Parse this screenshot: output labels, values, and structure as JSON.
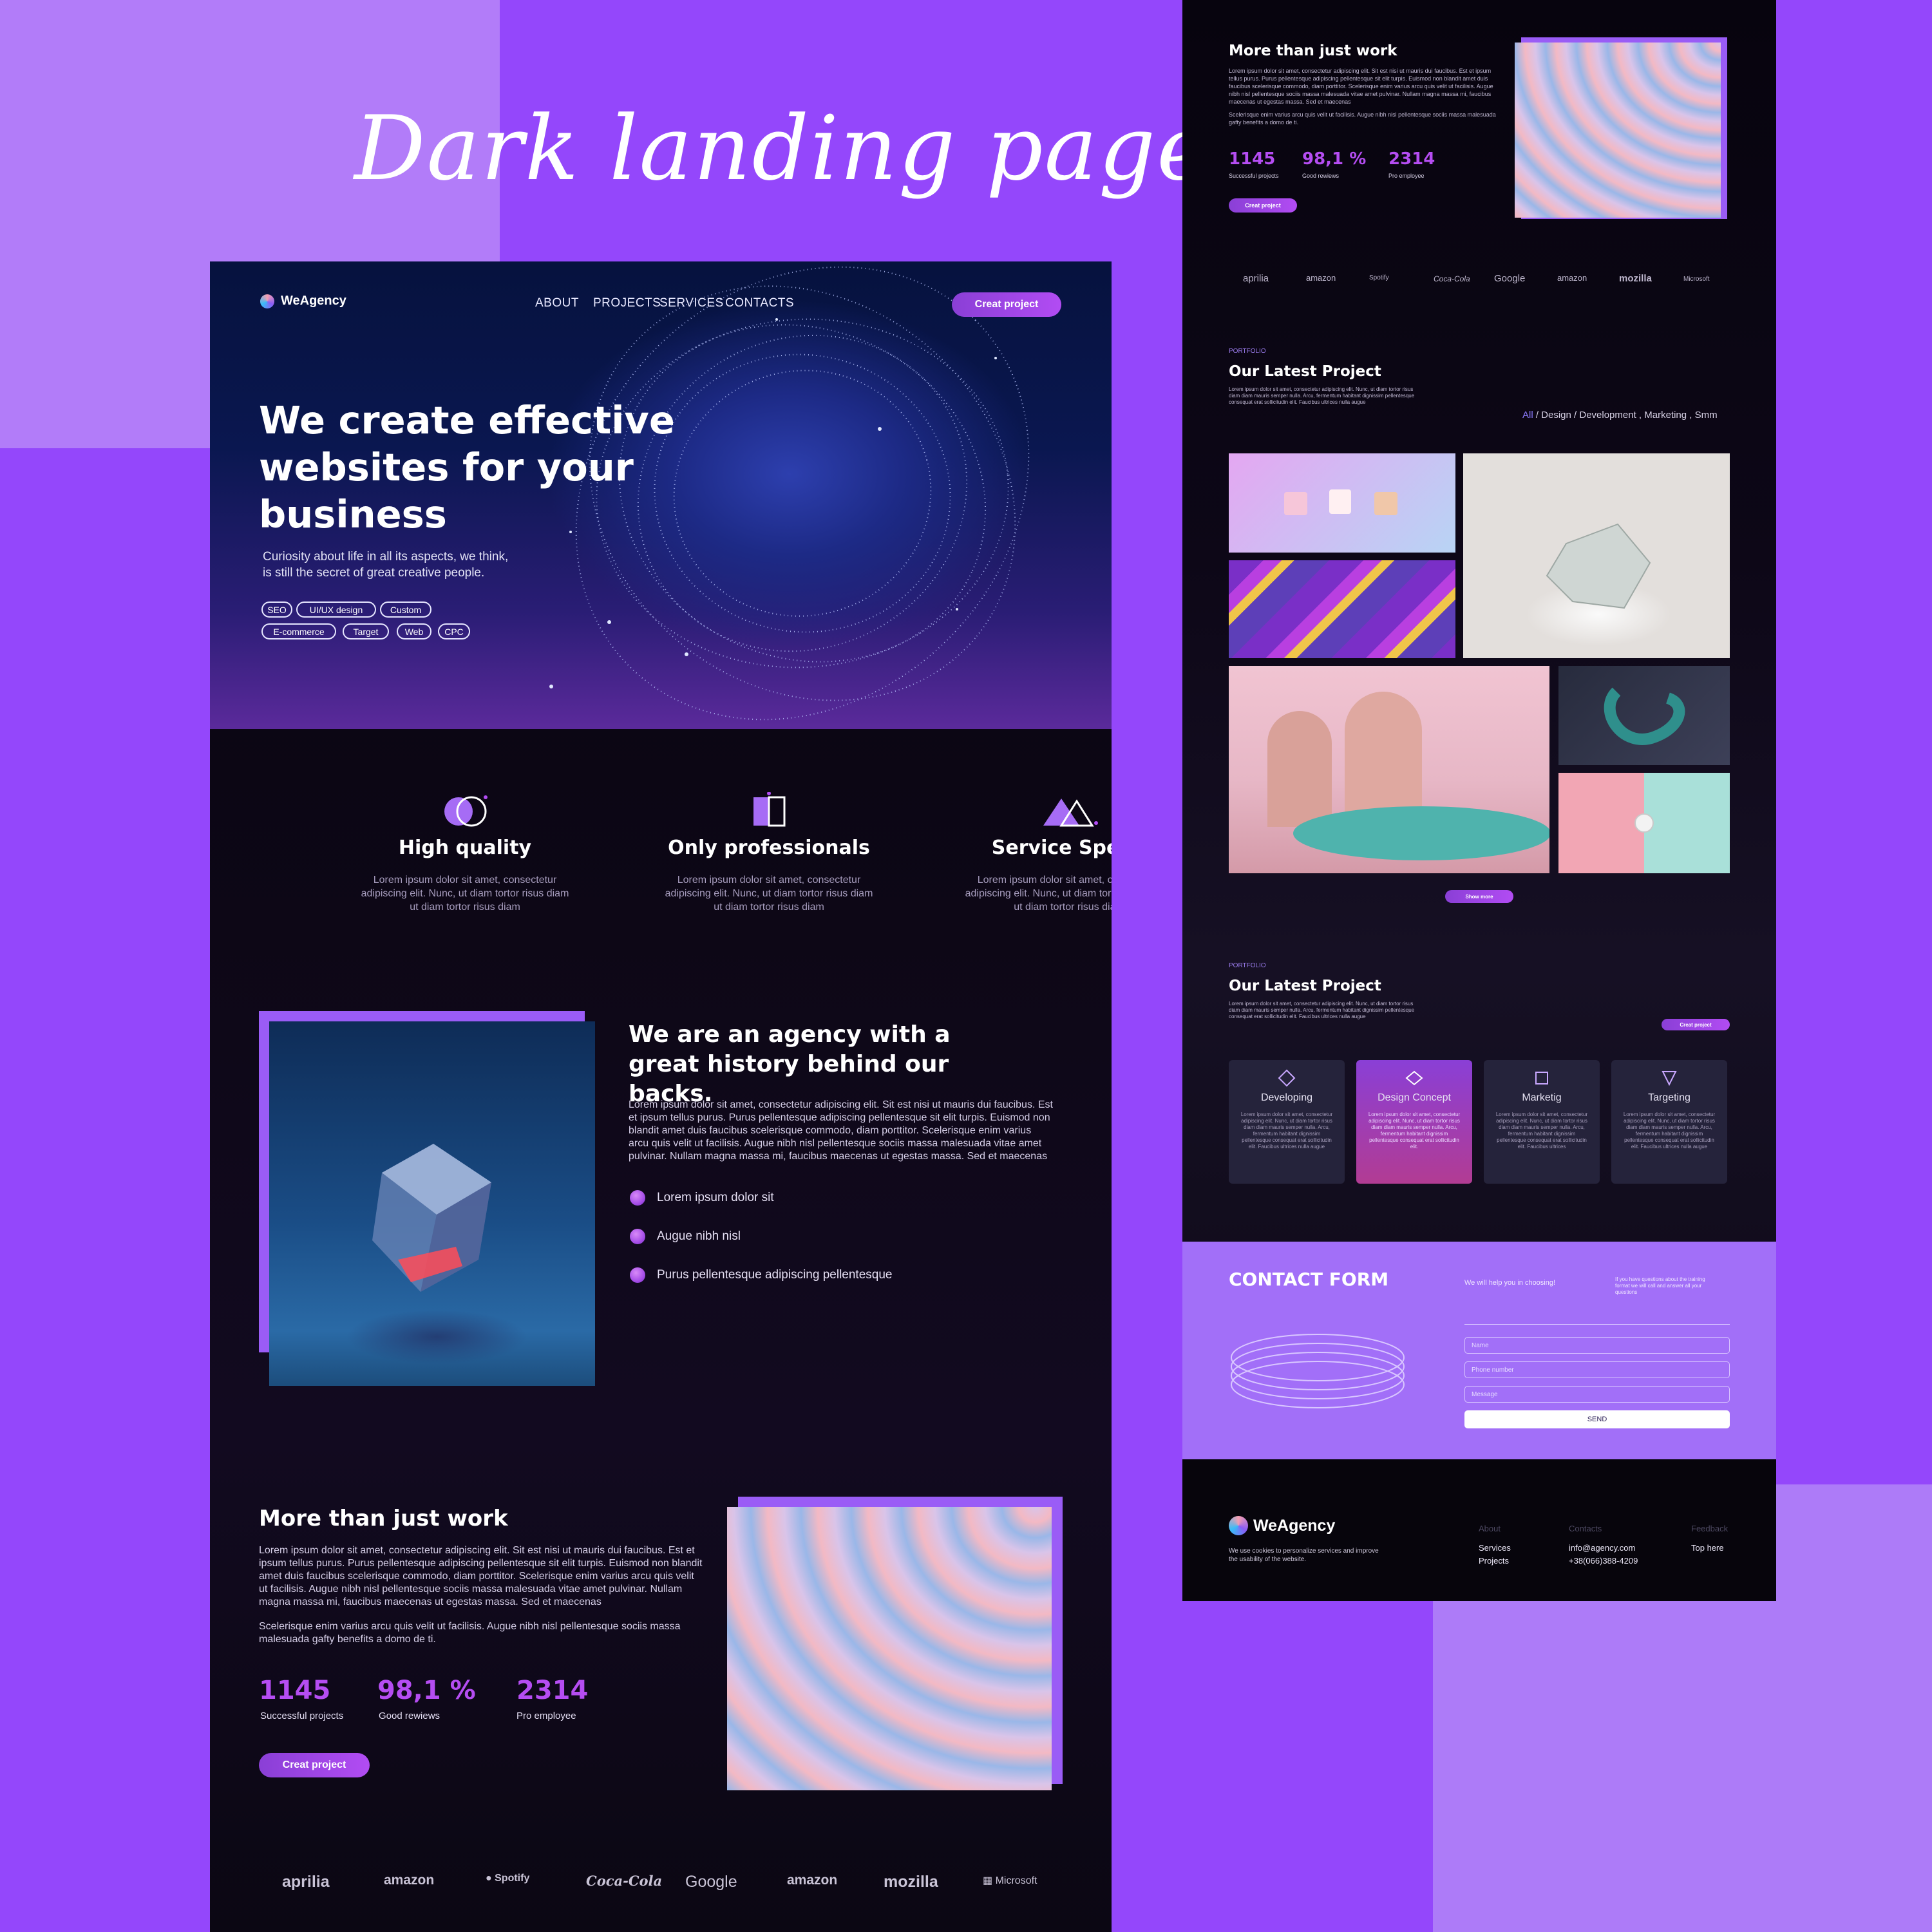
{
  "showcase": {
    "title": "Dark landing page"
  },
  "brand_name": "WeAgency",
  "nav": {
    "about": "ABOUT",
    "projects": "PROJECTS",
    "services": "SERVICES",
    "contacts": "CONTACTS",
    "cta": "Creat project"
  },
  "hero": {
    "title_line1": "We create effective",
    "title_line2": "websites  for your",
    "title_line3": "business",
    "sub_line1": "Curiosity about life in all its aspects, we think,",
    "sub_line2": "is still the secret of great creative people.",
    "tags": [
      "SEO",
      "UI/UX design",
      "Custom",
      "E-commerce",
      "Target",
      "Web",
      "CPC"
    ]
  },
  "features": [
    {
      "title": "High quality",
      "text": "Lorem ipsum dolor sit amet, consectetur adipiscing elit. Nunc, ut diam tortor risus diam ut diam tortor risus diam"
    },
    {
      "title": "Only professionals",
      "text": "Lorem ipsum dolor sit amet, consectetur adipiscing elit. Nunc, ut diam tortor risus diam ut diam tortor risus diam"
    },
    {
      "title": "Service Speed",
      "text": "Lorem ipsum dolor sit amet, consectetur adipiscing elit. Nunc, ut diam tortor risus diam ut diam tortor risus diam"
    }
  ],
  "about": {
    "title": "We are an agency with a great history behind our backs.",
    "body": "Lorem ipsum dolor sit amet, consectetur adipiscing elit. Sit est nisi ut mauris dui faucibus. Est et ipsum tellus purus. Purus pellentesque adipiscing pellentesque sit elit turpis. Euismod non blandit amet duis faucibus scelerisque commodo, diam porttitor. Scelerisque enim varius arcu quis velit ut facilisis. Augue nibh nisl pellentesque sociis massa malesuada vitae amet pulvinar. Nullam magna massa mi, faucibus maecenas ut egestas massa. Sed et maecenas",
    "bullets": [
      "Lorem ipsum dolor sit",
      "Augue nibh nisl",
      "Purus pellentesque adipiscing pellentesque"
    ]
  },
  "more": {
    "title": "More than just work",
    "body1": "Lorem ipsum dolor sit amet, consectetur adipiscing elit. Sit est nisi ut mauris dui faucibus. Est et ipsum tellus purus. Purus pellentesque adipiscing pellentesque sit elit turpis. Euismod non blandit amet duis faucibus scelerisque commodo, diam porttitor. Scelerisque enim varius arcu quis velit ut facilisis. Augue nibh nisl pellentesque sociis massa malesuada vitae amet pulvinar. Nullam magna massa mi, faucibus maecenas ut egestas massa. Sed et maecenas",
    "body2": "Scelerisque enim varius arcu quis velit ut facilisis. Augue nibh nisl pellentesque sociis massa malesuada gafty benefits a domo de ti.",
    "stats": [
      {
        "value": "1145",
        "label": "Successful projects"
      },
      {
        "value": "98,1 %",
        "label": "Good rewiews"
      },
      {
        "value": "2314",
        "label": "Pro  employee"
      }
    ],
    "cta": "Creat project"
  },
  "brands": [
    "aprilia",
    "amazon",
    "Spotify",
    "Coca-Cola",
    "Google",
    "amazon",
    "mozilla",
    "Microsoft"
  ],
  "right": {
    "more_stats": [
      {
        "value": "1145",
        "label": "Successful projects"
      },
      {
        "value": "98,1 %",
        "label": "Good rewiews"
      },
      {
        "value": "2314",
        "label": "Pro  employee"
      }
    ],
    "portfolio_label": "PORTFOLIO",
    "portfolio_title": "Our Latest Project",
    "portfolio_text": "Lorem ipsum dolor sit amet, consectetur adipiscing elit. Nunc, ut diam tortor risus diam diam mauris semper nulla. Arcu, fermentum habitant dignissim pellentesque consequat erat sollicitudin elit. Faucibus ultrices nulla augue",
    "filters": {
      "all": "All",
      "rest": " / Design / Development , Marketing , Smm"
    },
    "show_more": "Show more",
    "services_cta": "Creat project",
    "services": [
      {
        "title": "Developing",
        "text": "Lorem ipsum dolor sit amet, consectetur adipiscing elit. Nunc, ut diam tortor risus diam diam mauris semper nulla. Arcu, fermentum habitant dignissim pellentesque consequat erat sollicitudin elit. Faucibus ultrices nulla augue"
      },
      {
        "title": "Design Concept",
        "text": "Lorem ipsum dolor sit amet, consectetur adipiscing elit. Nunc, ut diam tortor risus diam diam mauris semper nulla. Arcu, fermentum habitant dignissim pellentesque consequat erat sollicitudin elit."
      },
      {
        "title": "Marketig",
        "text": "Lorem ipsum dolor sit amet, consectetur adipiscing elit. Nunc, ut diam tortor risus diam diam mauris semper nulla. Arcu, fermentum habitant dignissim pellentesque consequat erat sollicitudin elit. Faucibus ultrices"
      },
      {
        "title": "Targeting",
        "text": "Lorem ipsum dolor sit amet, consectetur adipiscing elit. Nunc, ut diam tortor risus diam diam mauris semper nulla. Arcu, fermentum habitant dignissim pellentesque consequat erat sollicitudin elit. Faucibus ultrices nulla augue"
      }
    ],
    "contact": {
      "title": "CONTACT FORM",
      "help": "We will help you in choosing!",
      "note": "If you have questions about the training format we will call and answer all your questions",
      "name_ph": "Name",
      "phone_ph": "Phone number",
      "message_ph": "Message",
      "send": "SEND"
    },
    "footer": {
      "brand": "WeAgency",
      "cookie": "We use cookies to personalize services and improve the usability of the website.",
      "col1_head": "About",
      "col1_a": "Services",
      "col1_b": "Projects",
      "col2_head": "Contacts",
      "email": "info@agency.com",
      "phone": "+38(066)388-4209",
      "col3_head": "Feedback",
      "top": "Top here"
    }
  }
}
